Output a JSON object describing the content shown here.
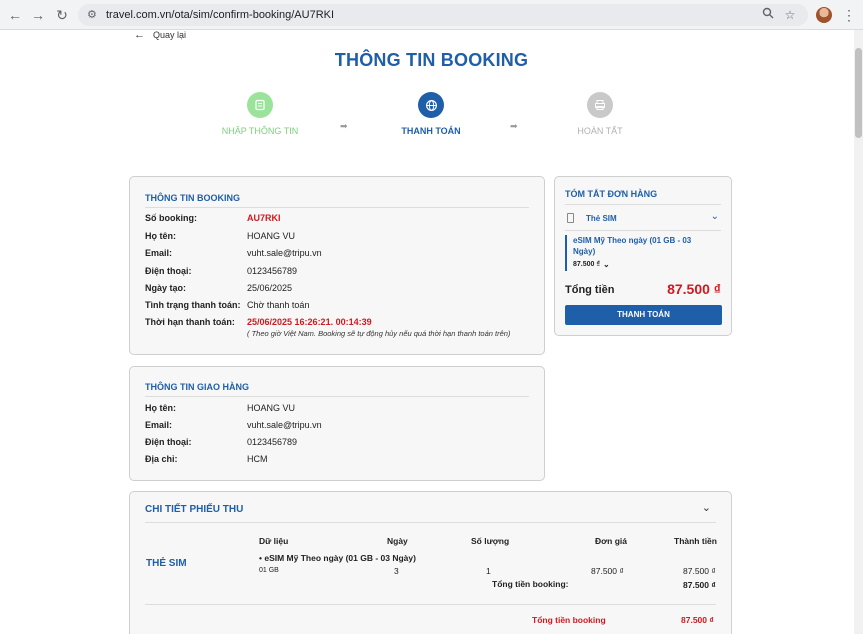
{
  "browser": {
    "url": "travel.com.vn/ota/sim/confirm-booking/AU7RKI",
    "nav": {
      "back": "←",
      "forward": "→",
      "reload": "↻"
    },
    "icons": [
      "site-info-icon",
      "zoom-icon",
      "star-icon",
      "avatar",
      "menu-icon"
    ]
  },
  "page": {
    "back_label": "Quay lại",
    "title": "THÔNG TIN BOOKING"
  },
  "steps": [
    {
      "label": "NHẬP THÔNG TIN",
      "state": "done",
      "color": "#7ed07e"
    },
    {
      "label": "THANH TOÁN",
      "state": "active",
      "color": "#1f5ea8"
    },
    {
      "label": "HOÀN TẤT",
      "state": "pending",
      "color": "#bdbdbd"
    }
  ],
  "step_arrow": "➡",
  "booking_info": {
    "heading": "THÔNG TIN BOOKING",
    "rows": [
      {
        "key": "Số booking:",
        "value": "AU7RKI"
      },
      {
        "key": "Họ tên:",
        "value": "HOANG VU"
      },
      {
        "key": "Email:",
        "value": "vuht.sale@tripu.vn"
      },
      {
        "key": "Điện thoại:",
        "value": "0123456789"
      },
      {
        "key": "Ngày tạo:",
        "value": "25/06/2025"
      },
      {
        "key": "Tình trạng thanh toán:",
        "value": "Chờ thanh toán"
      },
      {
        "key": "Thời hạn thanh toán:",
        "value": "25/06/2025 16:26:21. 00:14:39"
      }
    ],
    "note": "( Theo giờ Việt Nam. Booking sẽ tự động hủy nếu quá thời hạn thanh toán trên)"
  },
  "delivery_info": {
    "heading": "THÔNG TIN GIAO HÀNG",
    "rows": [
      {
        "key": "Họ tên:",
        "value": "HOANG VU"
      },
      {
        "key": "Email:",
        "value": "vuht.sale@tripu.vn"
      },
      {
        "key": "Điện thoại:",
        "value": "0123456789"
      },
      {
        "key": "Địa chỉ:",
        "value": "HCM"
      }
    ]
  },
  "order_summary": {
    "heading": "TÓM TẮT ĐƠN HÀNG",
    "category": "Thẻ SIM",
    "product_line1": "eSIM Mỹ Theo ngày (01 GB - 03",
    "product_line2": "Ngày)",
    "product_price": "87.500 ₫",
    "total_label": "Tổng tiền",
    "total_value": "87.500 ₫",
    "pay_button": "THANH TOÁN"
  },
  "receipt": {
    "heading": "CHI TIẾT PHIẾU THU",
    "section_label": "THẺ SIM",
    "columns": [
      "Dữ liệu",
      "Ngày",
      "Số lượng",
      "Đơn giá",
      "Thành tiền"
    ],
    "item": {
      "name": "• eSIM Mỹ Theo ngày (01 GB - 03 Ngày)",
      "data": "01 GB",
      "days": "3",
      "qty": "1",
      "unit_price": "87.500 ₫",
      "amount": "87.500 ₫"
    },
    "subtotal_label": "Tổng tiền booking:",
    "subtotal_value": "87.500 ₫",
    "grand_label": "Tổng tiền booking",
    "grand_value": "87.500 ₫"
  },
  "colors": {
    "primary": "#1f5ea8",
    "accent_red": "#d0191f",
    "done_green": "#7ed07e"
  }
}
